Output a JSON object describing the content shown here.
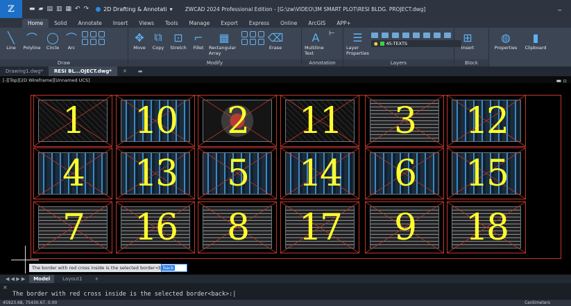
{
  "titlebar": {
    "workspace": "2D Drafting & Annotati",
    "title": "ZWCAD 2024 Professional Edition - [G:\\zw\\VIDEO\\3M SMART PLOT\\RESI BLDG. PROJECT.dwg]",
    "min": "_"
  },
  "tabs": [
    "Home",
    "Solid",
    "Annotate",
    "Insert",
    "Views",
    "Tools",
    "Manage",
    "Export",
    "Express",
    "Online",
    "ArcGIS",
    "APP+"
  ],
  "ribbon": {
    "draw": {
      "name": "Draw",
      "tools": [
        "Line",
        "Polyline",
        "Circle",
        "Arc"
      ]
    },
    "modify": {
      "name": "Modify",
      "tools": [
        "Move",
        "Copy",
        "Stretch",
        "Fillet",
        "Rectangular Array",
        "Erase"
      ]
    },
    "annotation": {
      "name": "Annotation",
      "tools": [
        "Multiline Text"
      ]
    },
    "layers": {
      "name": "Layers",
      "tools": [
        "Layer Properties"
      ],
      "current_layer": "45-TEXTS"
    },
    "block": {
      "name": "Block",
      "tools": [
        "Insert"
      ]
    },
    "extra": [
      "Properties",
      "Clipboard"
    ]
  },
  "doctabs": [
    "Drawing1.dwg*",
    "RESI BL...OJECT.dwg*"
  ],
  "view_label": "[-][Top][2D Wireframe][Unnamed UCS]",
  "sheets": [
    "1",
    "4",
    "7",
    "10",
    "13",
    "16",
    "2",
    "5",
    "8",
    "11",
    "14",
    "17",
    "3",
    "6",
    "9",
    "12",
    "15",
    "18"
  ],
  "tooltip": "The border with red cross inside is the selected border<back>",
  "tip_input": "back",
  "layout_tabs": [
    "Model",
    "Layout1",
    "+"
  ],
  "command_line": "The border with red cross inside is the selected border<back>:|",
  "status": {
    "coords": "45923.68, 75430.67, 0.00",
    "units": "Centimeters"
  }
}
